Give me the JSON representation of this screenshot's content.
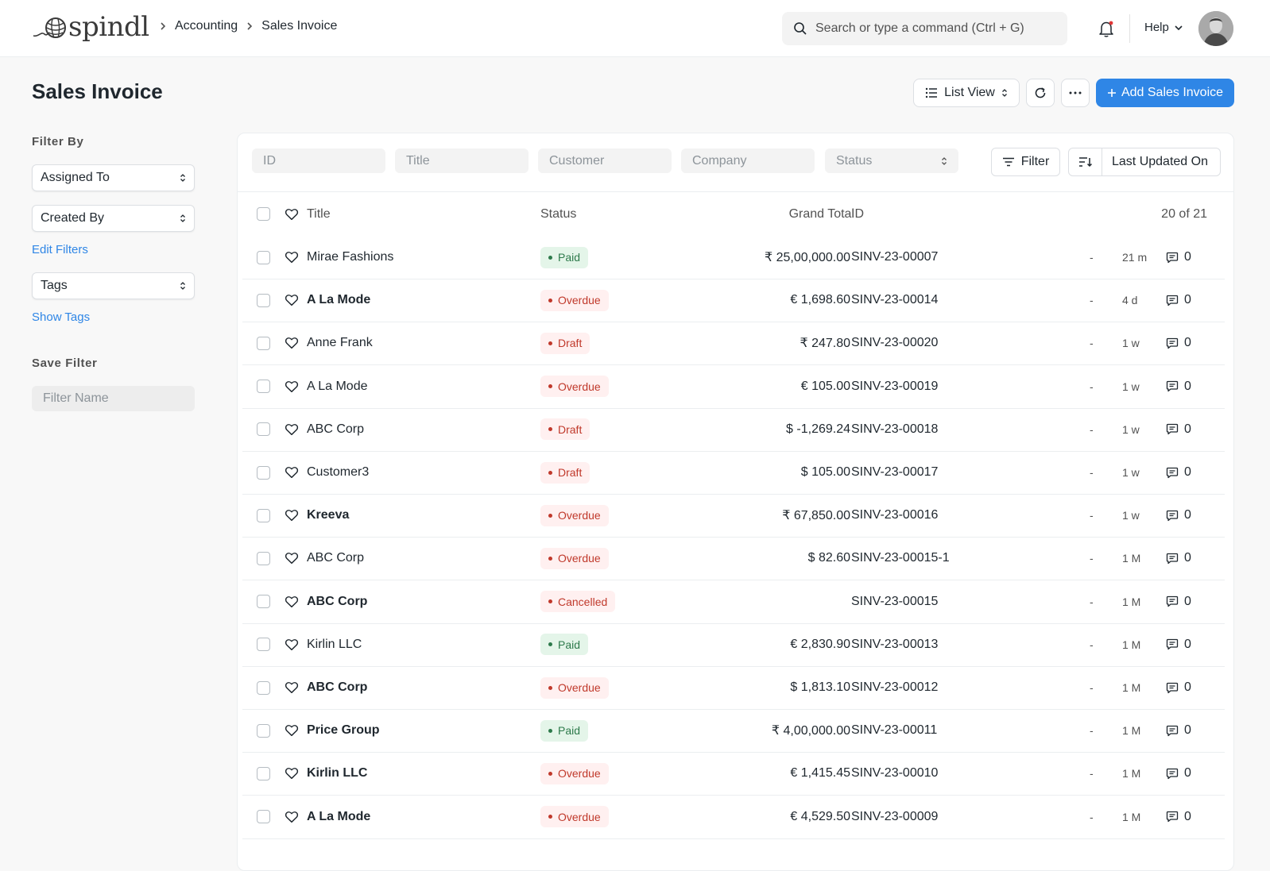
{
  "brand": {
    "name": "spindl"
  },
  "breadcrumb": [
    "Accounting",
    "Sales Invoice"
  ],
  "search": {
    "placeholder": "Search or type a command (Ctrl + G)"
  },
  "nav": {
    "help_label": "Help"
  },
  "page": {
    "title": "Sales Invoice",
    "list_view_label": "List View",
    "add_label": "Add Sales Invoice"
  },
  "sidebar": {
    "filter_by_label": "Filter By",
    "assigned_to": "Assigned To",
    "created_by": "Created By",
    "edit_filters": "Edit Filters",
    "tags": "Tags",
    "show_tags": "Show Tags",
    "save_filter_label": "Save Filter",
    "filter_name_placeholder": "Filter Name"
  },
  "filters": {
    "id_placeholder": "ID",
    "title_placeholder": "Title",
    "customer_placeholder": "Customer",
    "company_placeholder": "Company",
    "status_placeholder": "Status",
    "filter_label": "Filter",
    "sort_label": "Last Updated On"
  },
  "table": {
    "headers": {
      "title": "Title",
      "status": "Status",
      "grand_total": "Grand Total",
      "id": "ID",
      "count": "20 of 21"
    },
    "rows": [
      {
        "title": "Mirae Fashions",
        "bold": false,
        "status": "Paid",
        "status_color": "green",
        "total": "₹ 25,00,000.00",
        "id": "SINV-23-00007",
        "assigned": "-",
        "modified": "21 m",
        "comments": "0"
      },
      {
        "title": "A La Mode",
        "bold": true,
        "status": "Overdue",
        "status_color": "red",
        "total": "€ 1,698.60",
        "id": "SINV-23-00014",
        "assigned": "-",
        "modified": "4 d",
        "comments": "0"
      },
      {
        "title": "Anne Frank",
        "bold": false,
        "status": "Draft",
        "status_color": "red",
        "total": "₹ 247.80",
        "id": "SINV-23-00020",
        "assigned": "-",
        "modified": "1 w",
        "comments": "0"
      },
      {
        "title": "A La Mode",
        "bold": false,
        "status": "Overdue",
        "status_color": "red",
        "total": "€ 105.00",
        "id": "SINV-23-00019",
        "assigned": "-",
        "modified": "1 w",
        "comments": "0"
      },
      {
        "title": "ABC Corp",
        "bold": false,
        "status": "Draft",
        "status_color": "red",
        "total": "$ -1,269.24",
        "id": "SINV-23-00018",
        "assigned": "-",
        "modified": "1 w",
        "comments": "0"
      },
      {
        "title": "Customer3",
        "bold": false,
        "status": "Draft",
        "status_color": "red",
        "total": "$ 105.00",
        "id": "SINV-23-00017",
        "assigned": "-",
        "modified": "1 w",
        "comments": "0"
      },
      {
        "title": "Kreeva",
        "bold": true,
        "status": "Overdue",
        "status_color": "red",
        "total": "₹ 67,850.00",
        "id": "SINV-23-00016",
        "assigned": "-",
        "modified": "1 w",
        "comments": "0"
      },
      {
        "title": "ABC Corp",
        "bold": false,
        "status": "Overdue",
        "status_color": "red",
        "total": "$ 82.60",
        "id": "SINV-23-00015-1",
        "assigned": "-",
        "modified": "1 M",
        "comments": "0"
      },
      {
        "title": "ABC Corp",
        "bold": true,
        "status": "Cancelled",
        "status_color": "red",
        "total": "",
        "id": "SINV-23-00015",
        "assigned": "-",
        "modified": "1 M",
        "comments": "0"
      },
      {
        "title": "Kirlin LLC",
        "bold": false,
        "status": "Paid",
        "status_color": "green",
        "total": "€ 2,830.90",
        "id": "SINV-23-00013",
        "assigned": "-",
        "modified": "1 M",
        "comments": "0"
      },
      {
        "title": "ABC Corp",
        "bold": true,
        "status": "Overdue",
        "status_color": "red",
        "total": "$ 1,813.10",
        "id": "SINV-23-00012",
        "assigned": "-",
        "modified": "1 M",
        "comments": "0"
      },
      {
        "title": "Price Group",
        "bold": true,
        "status": "Paid",
        "status_color": "green",
        "total": "₹ 4,00,000.00",
        "id": "SINV-23-00011",
        "assigned": "-",
        "modified": "1 M",
        "comments": "0"
      },
      {
        "title": "Kirlin LLC",
        "bold": true,
        "status": "Overdue",
        "status_color": "red",
        "total": "€ 1,415.45",
        "id": "SINV-23-00010",
        "assigned": "-",
        "modified": "1 M",
        "comments": "0"
      },
      {
        "title": "A La Mode",
        "bold": true,
        "status": "Overdue",
        "status_color": "red",
        "total": "€ 4,529.50",
        "id": "SINV-23-00009",
        "assigned": "-",
        "modified": "1 M",
        "comments": "0"
      }
    ]
  },
  "icons": {
    "logo": "yarn-ball-icon",
    "search": "search-icon",
    "bell": "bell-icon",
    "help_dropdown": "chevron-down-icon",
    "list_view": "list-icon",
    "refresh": "refresh-icon",
    "more": "more-icon",
    "add": "plus-icon",
    "filter": "filter-icon",
    "sort": "sort-icon",
    "like": "heart-icon",
    "comment": "comment-icon"
  },
  "colors": {
    "accent": "#2f86e6",
    "paid": "#2d7a4b",
    "overdue": "#c0392b"
  }
}
